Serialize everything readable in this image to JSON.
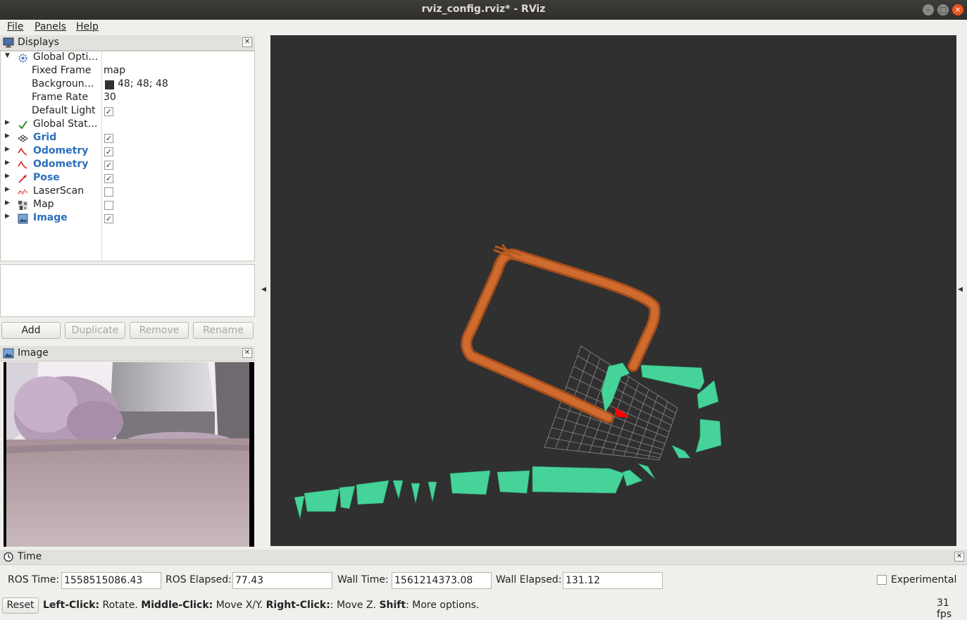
{
  "window": {
    "title": "rviz_config.rviz* - RViz"
  },
  "menu": [
    "File",
    "Panels",
    "Help"
  ],
  "displays_panel": {
    "title": "Displays",
    "rows": [
      {
        "label": "Global Opti…",
        "expanded": true,
        "icon": "gear-icon"
      },
      {
        "label": "Fixed Frame",
        "value": "map"
      },
      {
        "label": "Backgroun…",
        "value": "48; 48; 48",
        "swatch": "#303030"
      },
      {
        "label": "Frame Rate",
        "value": "30"
      },
      {
        "label": "Default Light",
        "checked": true
      },
      {
        "label": "Global Stat…",
        "icon": "checkmark-icon"
      },
      {
        "label": "Grid",
        "checked": true,
        "icon": "grid-icon"
      },
      {
        "label": "Odometry",
        "checked": true,
        "icon": "odometry-icon"
      },
      {
        "label": "Odometry",
        "checked": true,
        "icon": "odometry-icon"
      },
      {
        "label": "Pose",
        "checked": true,
        "icon": "pose-arrow-icon"
      },
      {
        "label": "LaserScan",
        "checked": false,
        "icon": "laserscan-icon"
      },
      {
        "label": "Map",
        "checked": false,
        "icon": "map-icon"
      },
      {
        "label": "Image",
        "checked": true,
        "icon": "image-icon"
      }
    ],
    "buttons": {
      "add": "Add",
      "duplicate": "Duplicate",
      "remove": "Remove",
      "rename": "Rename"
    }
  },
  "image_panel": {
    "title": "Image"
  },
  "time_panel": {
    "title": "Time",
    "ros_time_label": "ROS Time:",
    "ros_time": "1558515086.43",
    "ros_elapsed_label": "ROS Elapsed:",
    "ros_elapsed": "77.43",
    "wall_time_label": "Wall Time:",
    "wall_time": "1561214373.08",
    "wall_elapsed_label": "Wall Elapsed:",
    "wall_elapsed": "131.12",
    "experimental_label": "Experimental",
    "experimental_checked": false
  },
  "status": {
    "reset": "Reset",
    "left_click_key": "Left-Click:",
    "left_click_desc": "Rotate.",
    "middle_click_key": "Middle-Click:",
    "middle_click_desc": "Move X/Y.",
    "right_click_key": "Right-Click:",
    "right_click_desc": ": Move Z.",
    "shift_key": "Shift",
    "shift_desc": ": More options.",
    "fps": "31 fps"
  },
  "colors": {
    "accent": "#e95420",
    "odometry_path": "#c8662a",
    "laser_scan": "#46d39a",
    "pose_marker": "#ff0000",
    "viewport_bg": "#303030"
  }
}
